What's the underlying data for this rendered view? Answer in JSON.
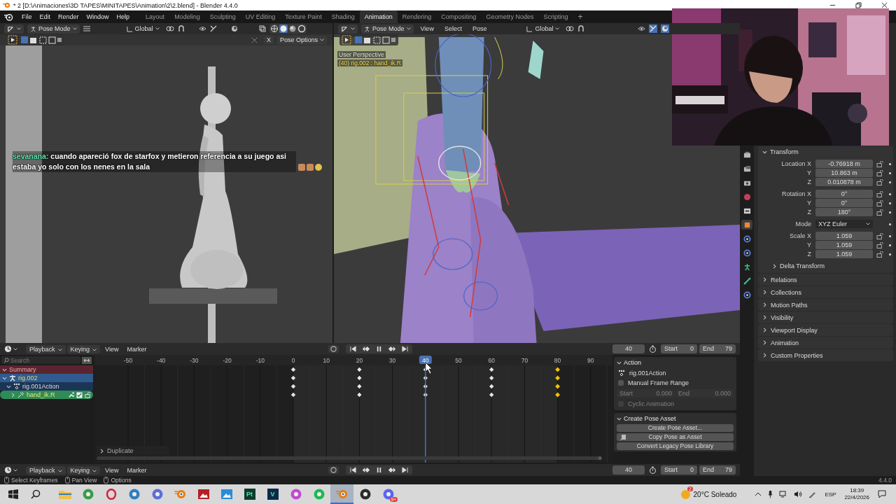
{
  "title_bar": {
    "title": "* 2 [D:\\Animaciones\\3D TAPES\\MINITAPES\\Animation\\2\\2.blend] - Blender 4.4.0"
  },
  "menu_bar": {
    "menus": [
      "File",
      "Edit",
      "Render",
      "Window",
      "Help"
    ],
    "workspaces": [
      {
        "label": "Layout",
        "selected": false
      },
      {
        "label": "Modeling",
        "selected": false
      },
      {
        "label": "Sculpting",
        "selected": false
      },
      {
        "label": "UV Editing",
        "selected": false
      },
      {
        "label": "Texture Paint",
        "selected": false
      },
      {
        "label": "Shading",
        "selected": false
      },
      {
        "label": "Animation",
        "selected": true
      },
      {
        "label": "Rendering",
        "selected": false
      },
      {
        "label": "Compositing",
        "selected": false
      },
      {
        "label": "Geometry Nodes",
        "selected": false
      },
      {
        "label": "Scripting",
        "selected": false
      }
    ],
    "add_tab": "+"
  },
  "left_viewport": {
    "mode": "Pose Mode",
    "orientation": "Global",
    "shading": [
      {
        "kind": "wireframe",
        "selected": false
      },
      {
        "kind": "solid",
        "selected": true
      },
      {
        "kind": "material",
        "selected": false
      },
      {
        "kind": "rendered",
        "selected": false
      }
    ],
    "x_button": "X",
    "pose_options": "Pose Options",
    "chat": {
      "user": "sevanana:",
      "message": "cuando apareció fox de starfox y metieron referencia a su juego asi estaba yo solo con los nenes en la sala"
    }
  },
  "right_viewport": {
    "mode": "Pose Mode",
    "menus": [
      "View",
      "Select",
      "Pose"
    ],
    "orientation": "Global",
    "overlay": [
      {
        "kind": "view",
        "text": "User Perspective"
      },
      {
        "kind": "selection",
        "text": "(40) rig.002 : hand_ik.R"
      }
    ]
  },
  "properties": {
    "tabs": [
      {
        "kind": "tool",
        "color": "#b8b8b8",
        "selected": false
      },
      {
        "kind": "render",
        "color": "#b8b8b8",
        "selected": false
      },
      {
        "kind": "output",
        "color": "#b8b8b8",
        "selected": false
      },
      {
        "kind": "world",
        "color": "#c0405a",
        "selected": false
      },
      {
        "kind": "collection",
        "color": "#d0d0d0",
        "selected": false
      },
      {
        "kind": "object",
        "color": "#f0883a",
        "selected": true
      },
      {
        "kind": "physics",
        "color": "#5a7fe0",
        "selected": false
      },
      {
        "kind": "constraint",
        "color": "#5a7fe0",
        "selected": false
      },
      {
        "kind": "armature",
        "color": "#3cc28a",
        "selected": false
      },
      {
        "kind": "bone",
        "color": "#3cc28a",
        "selected": false
      },
      {
        "kind": "bone_constraint",
        "color": "#5a7fe0",
        "selected": false
      }
    ],
    "transform": {
      "title": "Transform",
      "expanded": true,
      "groups": [
        {
          "rows": [
            {
              "kind": "number",
              "label": "Location X",
              "value": "-0.76918 m",
              "locked": false
            },
            {
              "kind": "number",
              "label": "Y",
              "value": "10.863 m",
              "locked": false
            },
            {
              "kind": "number",
              "label": "Z",
              "value": "0.010878 m",
              "locked": false
            }
          ]
        },
        {
          "rows": [
            {
              "kind": "number",
              "label": "Rotation X",
              "value": "0°",
              "locked": false
            },
            {
              "kind": "number",
              "label": "Y",
              "value": "0°",
              "locked": false
            },
            {
              "kind": "number",
              "label": "Z",
              "value": "180°",
              "locked": false
            }
          ]
        },
        {
          "rows": [
            {
              "kind": "dropdown",
              "label": "Mode",
              "value": "XYZ Euler"
            }
          ]
        },
        {
          "rows": [
            {
              "kind": "number",
              "label": "Scale X",
              "value": "1.059",
              "locked": false
            },
            {
              "kind": "number",
              "label": "Y",
              "value": "1.059",
              "locked": false
            },
            {
              "kind": "number",
              "label": "Z",
              "value": "1.059",
              "locked": false
            }
          ]
        }
      ],
      "subpanel": {
        "title": "Delta Transform",
        "expanded": false
      }
    },
    "panels": [
      {
        "title": "Relations",
        "expanded": false
      },
      {
        "title": "Collections",
        "expanded": false
      },
      {
        "title": "Motion Paths",
        "expanded": false
      },
      {
        "title": "Visibility",
        "expanded": false
      },
      {
        "title": "Viewport Display",
        "expanded": false
      },
      {
        "title": "Animation",
        "expanded": false
      },
      {
        "title": "Custom Properties",
        "expanded": false
      }
    ]
  },
  "dope_sheet": {
    "headers": [
      {
        "menus": [
          {
            "label": "Playback",
            "dropdown": true
          },
          {
            "label": "Keying",
            "dropdown": true
          },
          {
            "label": "View",
            "dropdown": false
          },
          {
            "label": "Marker",
            "dropdown": false
          }
        ],
        "playing": true,
        "current": "40",
        "start_label": "Start",
        "start": "0",
        "end_label": "End",
        "end": "79"
      },
      {
        "menus": [
          {
            "label": "Playback",
            "dropdown": true
          },
          {
            "label": "Keying",
            "dropdown": true
          },
          {
            "label": "View",
            "dropdown": false
          },
          {
            "label": "Marker",
            "dropdown": false
          }
        ],
        "playing": true,
        "current": "40",
        "start_label": "Start",
        "start": "0",
        "end_label": "End",
        "end": "79"
      }
    ],
    "search": {
      "placeholder": "Search"
    },
    "channels": [
      {
        "kind": "summary",
        "name": "Summary",
        "expanded": true
      },
      {
        "kind": "object",
        "name": "rig.002",
        "expanded": true,
        "children": [
          {
            "kind": "action",
            "name": "rig.001Action",
            "expanded": true,
            "children": [
              {
                "kind": "group",
                "name": "hand_ik.R",
                "expanded": false
              }
            ]
          }
        ]
      }
    ],
    "ticks": [
      {
        "label": "-50",
        "current": false
      },
      {
        "label": "-40",
        "current": false
      },
      {
        "label": "-30",
        "current": false
      },
      {
        "label": "-20",
        "current": false
      },
      {
        "label": "-10",
        "current": false
      },
      {
        "label": "0",
        "current": false,
        "keyframe": {
          "selected": false
        }
      },
      {
        "label": "10",
        "current": false
      },
      {
        "label": "20",
        "current": false,
        "keyframe": {
          "selected": false
        }
      },
      {
        "label": "30",
        "current": false
      },
      {
        "label": "40",
        "current": true,
        "keyframe": {
          "selected": false
        }
      },
      {
        "label": "50",
        "current": false
      },
      {
        "label": "60",
        "current": false,
        "keyframe": {
          "selected": false
        }
      },
      {
        "label": "70",
        "current": false
      },
      {
        "label": "80",
        "current": false,
        "keyframe": {
          "selected": true
        }
      },
      {
        "label": "90",
        "current": false
      }
    ],
    "operator_panel": {
      "title": "Duplicate",
      "expanded": false
    },
    "sidebar": {
      "action": {
        "title": "Action",
        "expanded": true,
        "name": "rig.001Action",
        "manual_range": {
          "label": "Manual Frame Range",
          "checked": false
        },
        "range": {
          "start_label": "Start",
          "start": "0.000",
          "end_label": "End",
          "end": "0.000",
          "disabled": true
        },
        "cyclic": {
          "label": "Cyclic Animation",
          "checked": false,
          "disabled": true
        }
      },
      "pose_asset": {
        "title": "Create Pose Asset",
        "expanded": true,
        "buttons": [
          {
            "kind": "plain",
            "label": "Create Pose Asset..."
          },
          {
            "kind": "icon",
            "label": "Copy Pose as Asset"
          },
          {
            "kind": "plain",
            "label": "Convert Legacy Pose Library"
          }
        ]
      }
    }
  },
  "status_bar": {
    "hints": [
      "Select Keyframes",
      "Pan View",
      "Options"
    ],
    "version": "4.4.0"
  },
  "taskbar": {
    "apps": [
      {
        "kind": "folder",
        "color": "#f2c14e",
        "active": false
      },
      {
        "kind": "circle",
        "color": "#3a9b4a",
        "active": false
      },
      {
        "kind": "ring",
        "color": "#d4263b",
        "active": false
      },
      {
        "kind": "circle",
        "color": "#2f7fbf",
        "active": false
      },
      {
        "kind": "circle",
        "color": "#5a6fd6",
        "active": false
      },
      {
        "kind": "eye",
        "color": "#e87d0d",
        "active": false
      },
      {
        "kind": "tile",
        "color": "#b51f24",
        "active": false
      },
      {
        "kind": "tile",
        "color": "#2a8bd6",
        "active": false
      },
      {
        "kind": "letter",
        "label": "Pt",
        "color": "#0c3b2e",
        "active": false
      },
      {
        "kind": "letter",
        "label": "V",
        "color": "#0b2a4a",
        "active": false
      },
      {
        "kind": "circle",
        "color": "#c14bd1",
        "active": false
      },
      {
        "kind": "circle",
        "color": "#1db954",
        "active": false
      },
      {
        "kind": "eye",
        "color": "#e87d0d",
        "active": true
      },
      {
        "kind": "circle",
        "color": "#2b2b2b",
        "active": false
      },
      {
        "kind": "circle",
        "color": "#5865f2",
        "active": false,
        "badge": "9+"
      }
    ],
    "weather": {
      "badge": "2",
      "text": "20°C Soleado"
    },
    "language": "ESP",
    "time": "18:39",
    "date": "22/4/2026"
  }
}
